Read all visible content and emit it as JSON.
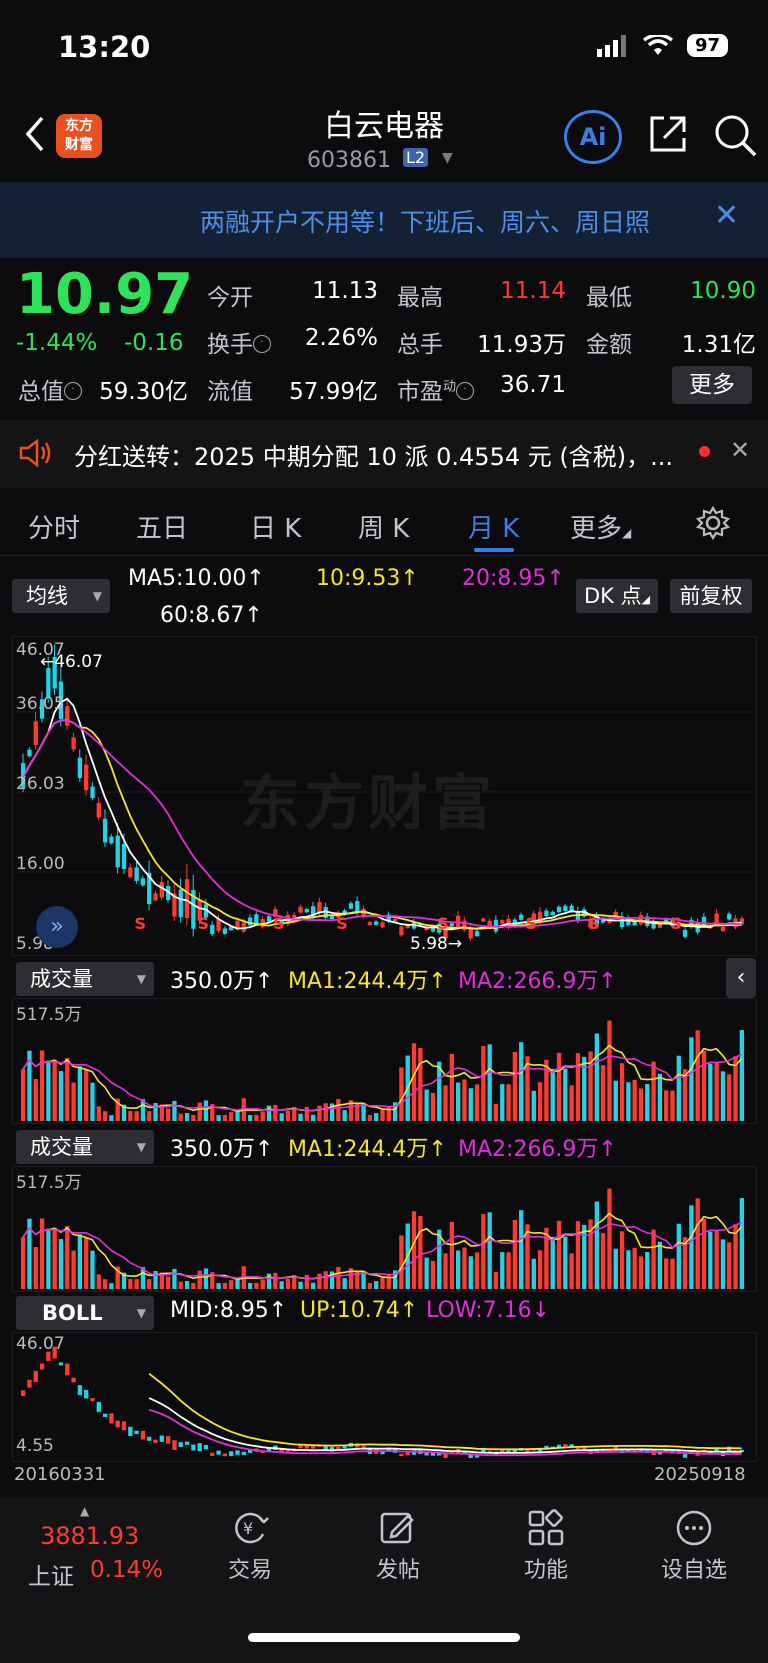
{
  "status": {
    "time": "13:20",
    "battery": "97"
  },
  "header": {
    "logo_line1": "东方",
    "logo_line2": "财富",
    "name": "白云电器",
    "code": "603861",
    "l2": "L2",
    "ai": "Ai"
  },
  "banner": {
    "text": "两融开户不用等！下班后、周六、周日照"
  },
  "quote": {
    "price": "10.97",
    "pct": "-1.44%",
    "chg": "-0.16",
    "open_label": "今开",
    "open": "11.13",
    "high_label": "最高",
    "high": "11.14",
    "low_label": "最低",
    "low": "10.90",
    "turnover_label": "换手",
    "turnover": "2.26%",
    "vol_label": "总手",
    "vol": "11.93万",
    "amount_label": "金额",
    "amount": "1.31亿",
    "mktcap_label": "总值",
    "mktcap": "59.30亿",
    "float_label": "流值",
    "float": "57.99亿",
    "pe_label": "市盈",
    "pe_sup": "动",
    "pe": "36.71",
    "more": "更多"
  },
  "notice": {
    "text": "分红送转：2025 中期分配 10 派 0.4554 元 (含税)，..."
  },
  "tabs": [
    "分时",
    "五日",
    "日 K",
    "周 K",
    "月 K",
    "更多"
  ],
  "main_panel": {
    "indicator": "均线",
    "ma5": "MA5:10.00↑",
    "ma10": "10:9.53↑",
    "ma20": "20:8.95↑",
    "ma60": "60:8.67↑",
    "dk": "DK 点",
    "adjust": "前复权",
    "y_top": "46.07",
    "y_2": "36.05",
    "y_3": "26.03",
    "y_4": "16.00",
    "y_bot": "5.98",
    "peak_label": "←46.07",
    "low_label": "5.98→",
    "watermark": "东方财富"
  },
  "vol_panel": {
    "name": "成交量",
    "vol": "350.0万↑",
    "ma1": "MA1:244.4万↑",
    "ma2": "MA2:266.9万↑",
    "max": "517.5万"
  },
  "vol_panel2": {
    "name": "成交量",
    "vol": "350.0万↑",
    "ma1": "MA1:244.4万↑",
    "ma2": "MA2:266.9万↑",
    "max": "517.5万"
  },
  "boll_panel": {
    "name": "BOLL",
    "mid": "MID:8.95↑",
    "up": "UP:10.74↑",
    "low": "LOW:7.16↓",
    "y_top": "46.07",
    "y_bot": "4.55"
  },
  "dates": {
    "start": "20160331",
    "end": "20250918"
  },
  "bottom_nav": {
    "index_value": "3881.93",
    "index_name": "上证",
    "index_pct": "0.14%",
    "trade": "交易",
    "post": "发帖",
    "func": "功能",
    "watch": "设自选"
  },
  "colors": {
    "up": "#ff3b30",
    "down": "#2ee35a",
    "accent": "#3a7ee6",
    "ma5": "#ffffff",
    "ma10": "#f5e431",
    "ma20": "#e22fd8",
    "cyan": "#22d3e6"
  }
}
